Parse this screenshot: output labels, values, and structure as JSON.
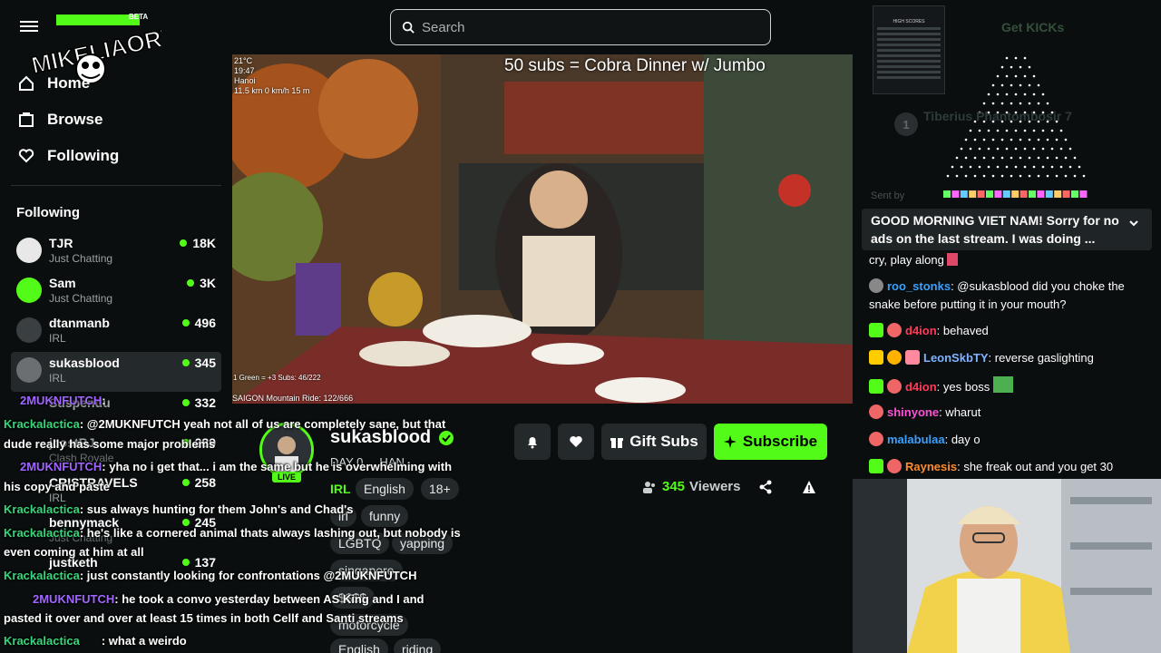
{
  "header": {
    "logo_text": "MIKELIAORY",
    "beta_label": "BETA",
    "search_placeholder": "Search"
  },
  "nav": {
    "home": "Home",
    "browse": "Browse",
    "following": "Following"
  },
  "following_section": {
    "title": "Following",
    "channels": [
      {
        "name": "TJR",
        "category": "Just Chatting",
        "viewers": "18K"
      },
      {
        "name": "Sam",
        "category": "Just Chatting",
        "viewers": "3K"
      },
      {
        "name": "dtanmanb",
        "category": "IRL",
        "viewers": "496"
      },
      {
        "name": "sukasblood",
        "category": "IRL",
        "viewers": "345"
      },
      {
        "name": "Suspendu",
        "category": "",
        "viewers": "332"
      },
      {
        "name": "jcostBJ",
        "category": "Clash Royale",
        "viewers": "289"
      },
      {
        "name": "CRISTRAVELS",
        "category": "IRL",
        "viewers": "258"
      },
      {
        "name": "bennymack",
        "category": "Just Chatting",
        "viewers": "245"
      },
      {
        "name": "justketh",
        "category": "",
        "viewers": "137"
      }
    ]
  },
  "video": {
    "title_overlay": "50 subs = Cobra Dinner w/ Jumbo",
    "hud": {
      "temp": "21°C",
      "time": "19:47",
      "city": "Hanoi",
      "stats": "11.5 km  0 km/h  15 m"
    },
    "green_text": "1 Green = +3 Subs: 46/222",
    "ride_text": "SAIGON Mountain Ride: 122/666"
  },
  "streamer": {
    "name": "sukasblood",
    "live": "LIVE",
    "subtitle": "DAY 0 ... HAN...",
    "category": "IRL",
    "tags": [
      "English",
      "18+",
      "irl",
      "funny",
      "LGBTQ",
      "yapping",
      "singapore",
      "$$$$",
      "motorcycle",
      "English",
      "riding"
    ],
    "gift_subs": "Gift Subs",
    "subscribe": "Subscribe",
    "viewer_count": "345",
    "viewers_label": "Viewers"
  },
  "overlay_chat": [
    {
      "user": "2MUKNFUTCH",
      "msg": ":"
    },
    {
      "user": "Krackalactica",
      "msg": ": @2MUKNFUTCH yeah not all of us are completely sane, but that"
    },
    {
      "user": "",
      "msg": "dude really has some major problems"
    },
    {
      "user": "2MUKNFUTCH",
      "msg": ": yha no i get that... i am the same but he is overwhelming with"
    },
    {
      "user": "",
      "msg": "his copy and paste"
    },
    {
      "user": "Krackalactica",
      "msg": ": sus always hunting for them John's and Chad's"
    },
    {
      "user": "Krackalactica",
      "msg": ": he's like a cornered animal thats always lashing out, but nobody is"
    },
    {
      "user": "",
      "msg": "even coming at him at all"
    },
    {
      "user": "Krackalactica",
      "msg": ": just constantly looking for confrontations @2MUKNFUTCH"
    },
    {
      "user": "2MUKNFUTCH",
      "msg": ": he took a convo yesterday between AS King and I and"
    },
    {
      "user": "",
      "msg": "pasted it over and over at least 15 times in both Cellf and Santi streams"
    },
    {
      "user": "Krackalactica",
      "msg": ": what a weirdo"
    }
  ],
  "right_panel": {
    "get_kicks": "Get KICKs",
    "high_scores": "HIGH SCORES",
    "leader_rank": "1",
    "leader_text": "Tiberius  Phantombosir  7",
    "sent_by": "Sent by",
    "pinned": "GOOD MORNING VIET NAM! Sorry for no ads on the last stream. I was doing ...",
    "chat": [
      {
        "user": "",
        "color": "#ffffff",
        "msg": "cry, play along"
      },
      {
        "user": "roo_stonks",
        "color": "#3aa0ff",
        "msg": ": @sukasblood did you choke the snake before putting it in your mouth?"
      },
      {
        "user": "d4ion",
        "color": "#ff3b5c",
        "msg": ":                     behaved"
      },
      {
        "user": "LeonSkbTY",
        "color": "#7fb3ff",
        "msg": ": reverse gaslighting"
      },
      {
        "user": "d4ion",
        "color": "#ff3b5c",
        "msg": ": yes boss"
      },
      {
        "user": "shinyone",
        "color": "#ff4fd8",
        "msg": ": wharut"
      },
      {
        "user": "malabulaa",
        "color": "#3aa0ff",
        "msg": ": day o"
      },
      {
        "user": "Raynesis",
        "color": "#ff8a2b",
        "msg": ": she freak out and you get 30"
      }
    ]
  },
  "colors": {
    "accent": "#53fc18",
    "bg": "#0b0e0f",
    "panel": "#24292b"
  }
}
